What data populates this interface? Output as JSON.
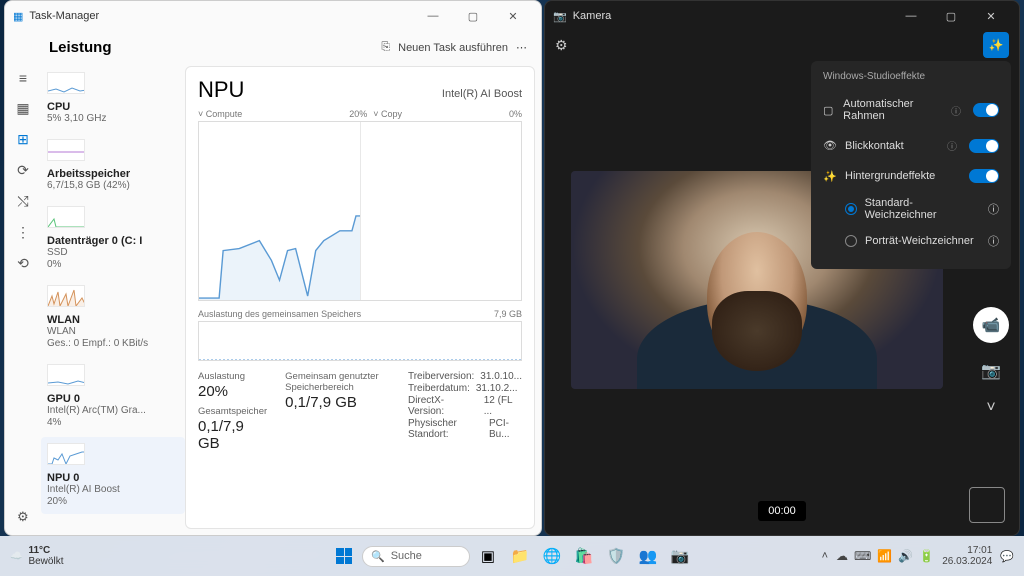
{
  "taskManager": {
    "title": "Task-Manager",
    "headerTitle": "Leistung",
    "newTask": "Neuen Task ausführen",
    "railIcons": [
      "≡",
      "▦",
      "⊞",
      "⟳",
      "⤭",
      "⋮",
      "⟲"
    ],
    "side": [
      {
        "name": "CPU",
        "sub": "5% 3,10 GHz"
      },
      {
        "name": "Arbeitsspeicher",
        "sub": "6,7/15,8 GB (42%)"
      },
      {
        "name": "Datenträger 0 (C: I",
        "sub": "SSD\n0%"
      },
      {
        "name": "WLAN",
        "sub": "WLAN\nGes.: 0 Empf.: 0 KBit/s"
      },
      {
        "name": "GPU 0",
        "sub": "Intel(R) Arc(TM) Gra...\n4%"
      },
      {
        "name": "NPU 0",
        "sub": "Intel(R) AI Boost\n20%"
      }
    ],
    "main": {
      "title": "NPU",
      "subtitle": "Intel(R) AI Boost",
      "computeLabel": "˅ Compute",
      "computePct": "20%",
      "copyLabel": "˅ Copy",
      "copyPct": "0%",
      "memLabel": "Auslastung des gemeinsamen Speichers",
      "memMax": "7,9 GB",
      "stats": {
        "auslastungLbl": "Auslastung",
        "auslastungVal": "20%",
        "gemLbl": "Gemeinsam genutzter Speicherbereich",
        "gemVal": "0,1/7,9 GB",
        "gesLbl": "Gesamtspeicher",
        "gesVal": "0,1/7,9 GB",
        "driver": [
          [
            "Treiberversion:",
            "31.0.10..."
          ],
          [
            "Treiberdatum:",
            "31.10.2..."
          ],
          [
            "DirectX-Version:",
            "12 (FL ..."
          ],
          [
            "Physischer Standort:",
            "PCI-Bu..."
          ]
        ]
      }
    }
  },
  "camera": {
    "title": "Kamera",
    "panelTitle": "Windows-Studioeffekte",
    "rows": [
      {
        "icon": "▢",
        "label": "Automatischer Rahmen"
      },
      {
        "icon": "👁",
        "label": "Blickkontakt"
      },
      {
        "icon": "✨",
        "label": "Hintergrundeffekte"
      }
    ],
    "radios": [
      {
        "label": "Standard-Weichzeichner",
        "on": true
      },
      {
        "label": "Porträt-Weichzeichner",
        "on": false
      }
    ],
    "timer": "00:00"
  },
  "taskbar": {
    "weatherTemp": "11°C",
    "weatherCond": "Bewölkt",
    "searchPlaceholder": "Suche",
    "clockTime": "17:01",
    "clockDate": "26.03.2024"
  }
}
